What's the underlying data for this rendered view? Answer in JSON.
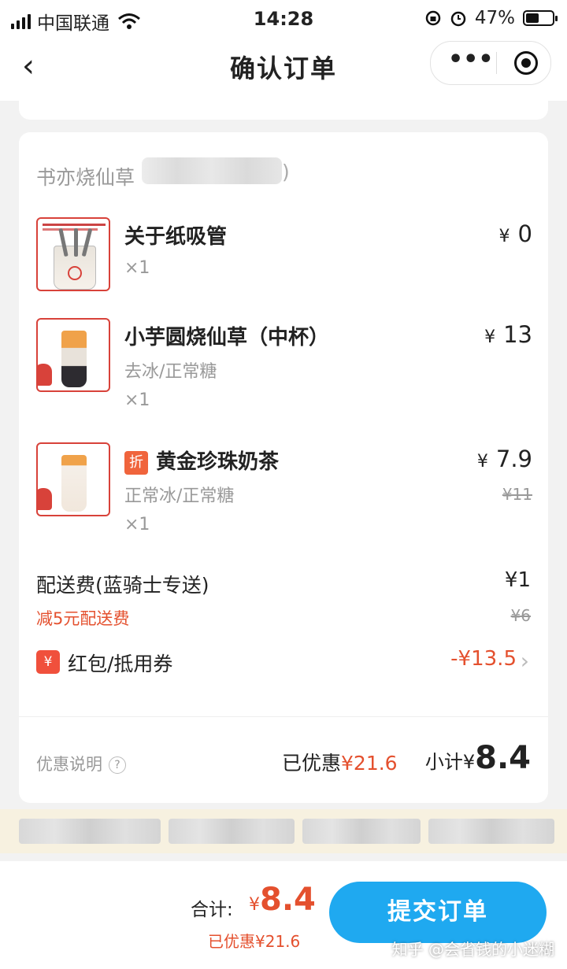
{
  "status_bar": {
    "carrier": "中国联通",
    "time": "14:28",
    "battery": "47%"
  },
  "nav": {
    "title": "确认订单"
  },
  "store": {
    "name": "书亦烧仙草",
    "name_suffix": ")"
  },
  "items": [
    {
      "name": "关于纸吸管",
      "spec": "",
      "qty": "×1",
      "currency": "¥",
      "price": "0",
      "original_price": "",
      "discount_badge": ""
    },
    {
      "name": "小芋圆烧仙草（中杯）",
      "spec": "去冰/正常糖",
      "qty": "×1",
      "currency": "¥",
      "price": "13",
      "original_price": "",
      "discount_badge": ""
    },
    {
      "name": "黄金珍珠奶茶",
      "spec": "正常冰/正常糖",
      "qty": "×1",
      "currency": "¥",
      "price": "7.9",
      "original_price": "¥11",
      "discount_badge": "折"
    }
  ],
  "delivery": {
    "label": "配送费(蓝骑士专送)",
    "value": "¥1",
    "discount_note": "减5元配送费",
    "original": "¥6"
  },
  "coupon": {
    "icon": "¥",
    "label": "红包/抵用券",
    "value": "-¥13.5"
  },
  "summary": {
    "promo_label": "优惠说明",
    "saved_label": "已优惠",
    "saved_value": "¥21.6",
    "subtotal_label": "小计¥",
    "subtotal_value": "8.4"
  },
  "bottom": {
    "total_label": "合计:",
    "total_currency": "¥",
    "total_value": "8.4",
    "saved_text": "已优惠¥21.6",
    "submit_label": "提交订单"
  },
  "watermark": "知乎 @会省钱的小迷糊",
  "colors": {
    "accent_red": "#e4502e",
    "submit_blue": "#1fa9f0",
    "thumb_border": "#d8423a"
  }
}
